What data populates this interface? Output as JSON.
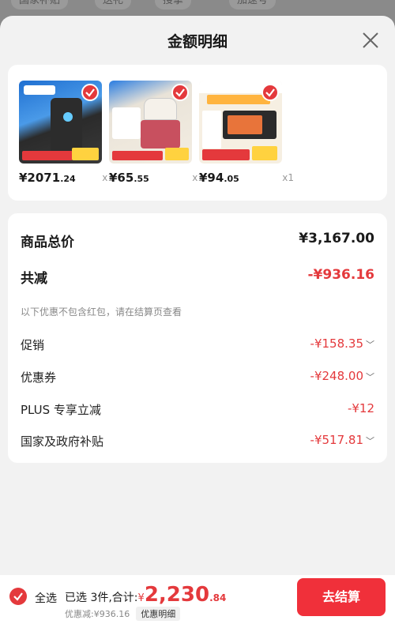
{
  "background_tabs": [
    "国家补贴",
    "送礼",
    "搜拿",
    "加速号"
  ],
  "sheet": {
    "title": "金额明细",
    "close_icon": "close-icon"
  },
  "products": [
    {
      "price_int": "¥2071",
      "price_dec": ".24",
      "qty": "x1",
      "thumb_color": "#3a7bd5",
      "icon": "juicer-product-image"
    },
    {
      "price_int": "¥65",
      "price_dec": ".55",
      "qty": "x1",
      "thumb_color": "#e8e2d6",
      "icon": "chopper-product-image"
    },
    {
      "price_int": "¥94",
      "price_dec": ".05",
      "qty": "x1",
      "thumb_color": "#f3ede0",
      "icon": "oven-product-image"
    }
  ],
  "details": {
    "total_label": "商品总价",
    "total_value": "¥3,167.00",
    "reduce_label": "共减",
    "reduce_value": "-¥936.16",
    "note": "以下优惠不包含红包，请在结算页查看",
    "items": [
      {
        "label": "促销",
        "value": "-¥158.35"
      },
      {
        "label": "优惠券",
        "value": "-¥248.00"
      },
      {
        "label": "PLUS 专享立减",
        "value": "-¥12"
      },
      {
        "label": "国家及政府补贴",
        "value": "-¥517.81"
      }
    ]
  },
  "bottom": {
    "select_all": "全选",
    "selected_text": "已选 3件,合计:",
    "currency": "¥",
    "amount_int": "2,230",
    "amount_dec": ".84",
    "discount_text": "优惠减:¥936.16",
    "discount_button": "优惠明细",
    "checkout": "去结算"
  },
  "colors": {
    "accent": "#e4393c",
    "checkout": "#f0303a"
  }
}
